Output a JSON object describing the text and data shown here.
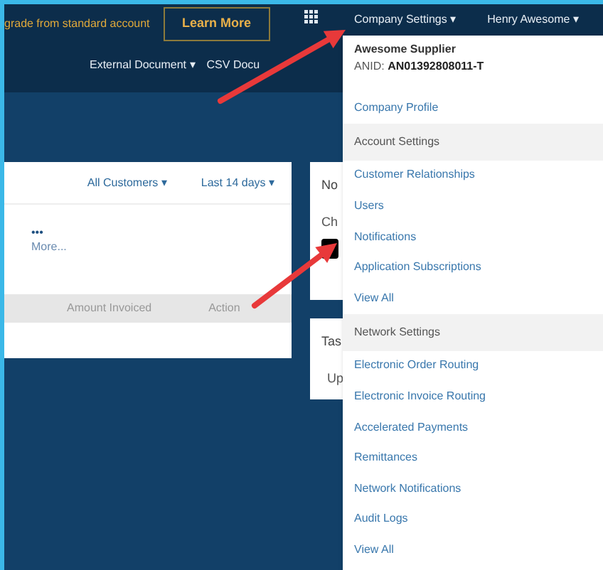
{
  "top_bar": {
    "promo_text": "grade from standard account",
    "learn_more_button": "Learn More",
    "company_settings_menu": "Company Settings ▾",
    "user_menu": "Henry Awesome ▾"
  },
  "sub_nav": [
    "External Document ▾",
    "CSV Docu"
  ],
  "main_card": {
    "filters": [
      "All Customers ▾",
      "Last 14 days ▾"
    ],
    "more_dots": "•••",
    "more_link": "More...",
    "columns": [
      "Amount Invoiced",
      "Action"
    ]
  },
  "side_cards": [
    {
      "title": "No",
      "text": "Ch"
    },
    {
      "title": "Tas",
      "text": "Up"
    }
  ],
  "dropdown": {
    "company_name": "Awesome Supplier",
    "anid_label": "ANID:",
    "anid_value": "AN01392808011-T",
    "entries": [
      {
        "kind": "link",
        "label": "Company Profile"
      },
      {
        "kind": "section",
        "label": "Account Settings"
      },
      {
        "kind": "link",
        "label": "Customer Relationships"
      },
      {
        "kind": "link",
        "label": "Users"
      },
      {
        "kind": "link",
        "label": "Notifications"
      },
      {
        "kind": "link",
        "label": "Application Subscriptions"
      },
      {
        "kind": "link",
        "label": "View All"
      },
      {
        "kind": "section",
        "label": "Network Settings"
      },
      {
        "kind": "link",
        "label": "Electronic Order Routing"
      },
      {
        "kind": "link",
        "label": "Electronic Invoice Routing"
      },
      {
        "kind": "link",
        "label": "Accelerated Payments"
      },
      {
        "kind": "link",
        "label": "Remittances"
      },
      {
        "kind": "link",
        "label": "Network Notifications"
      },
      {
        "kind": "link",
        "label": "Audit Logs"
      },
      {
        "kind": "link",
        "label": "View All"
      }
    ]
  }
}
